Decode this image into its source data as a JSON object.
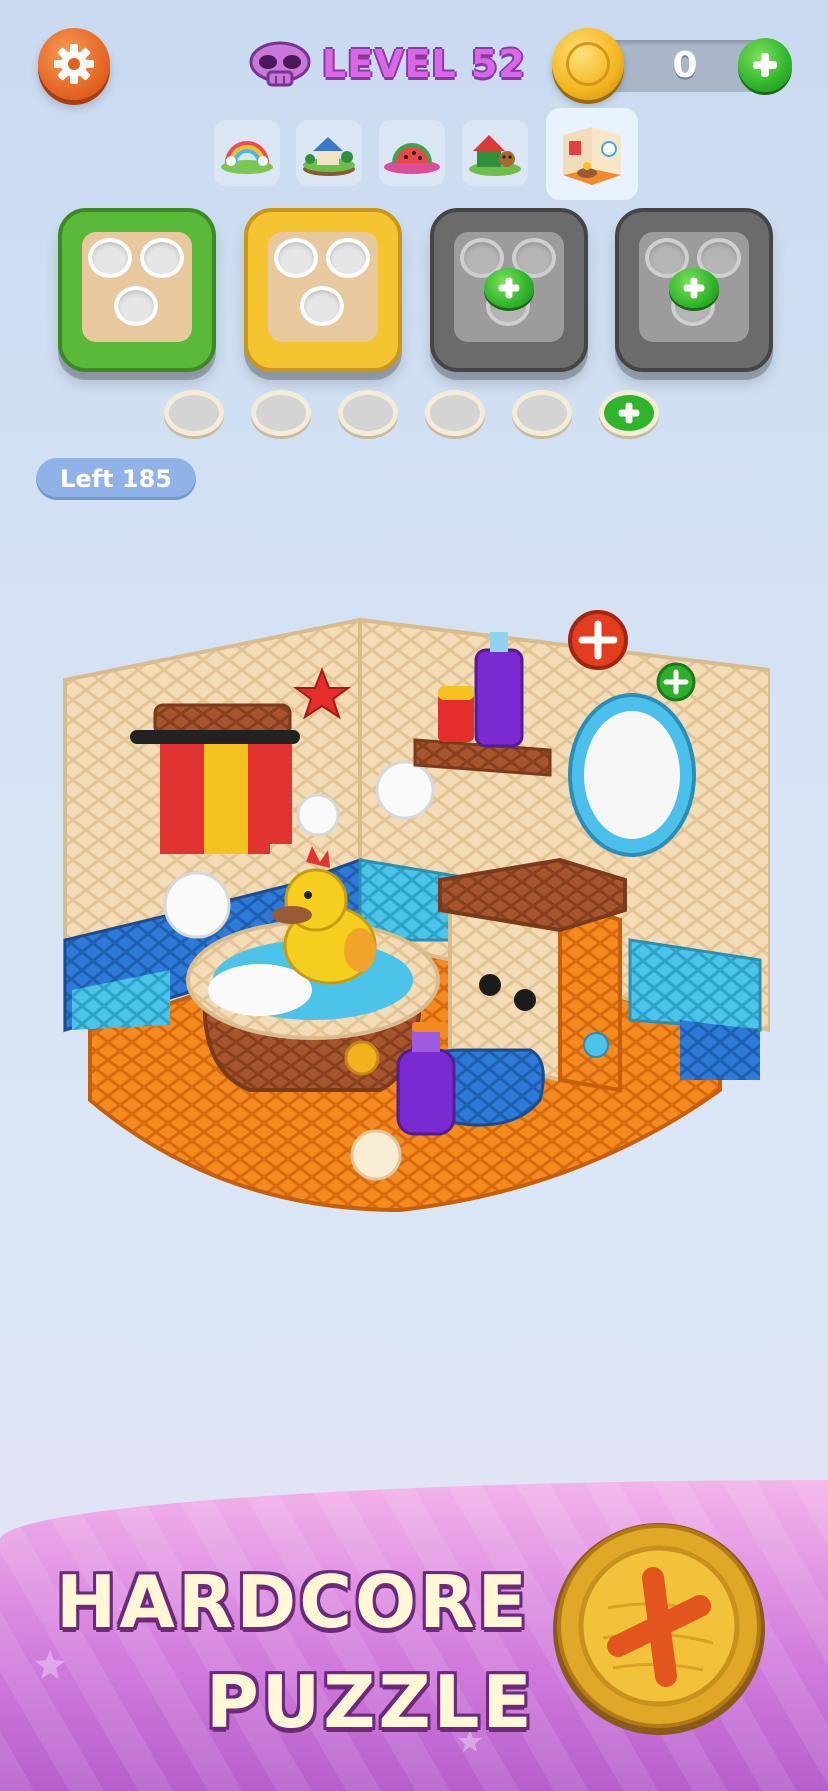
{
  "header": {
    "level_label": "LEVEL 52",
    "coins": "0"
  },
  "level_thumbnails": [
    "rainbow-island-icon",
    "house-island-icon",
    "watermelon-island-icon",
    "doghouse-island-icon",
    "bathroom-room-icon"
  ],
  "active_thumbnail": 4,
  "baskets": [
    {
      "color": "#5bb93a",
      "state": "open"
    },
    {
      "color": "#f4c531",
      "state": "open"
    },
    {
      "color": "#6b6b6b",
      "state": "locked"
    },
    {
      "color": "#6b6b6b",
      "state": "locked"
    }
  ],
  "slots": {
    "empty": 5,
    "locked": 1
  },
  "status": {
    "left_label": "Left 185"
  },
  "banner": {
    "line1": "HARDCORE",
    "line2": "PUZZLE"
  },
  "colors": {
    "accent_purple": "#d968e8",
    "settings_orange": "#e2601e",
    "plus_green": "#2fb52a",
    "coin_gold": "#f3b51f"
  }
}
